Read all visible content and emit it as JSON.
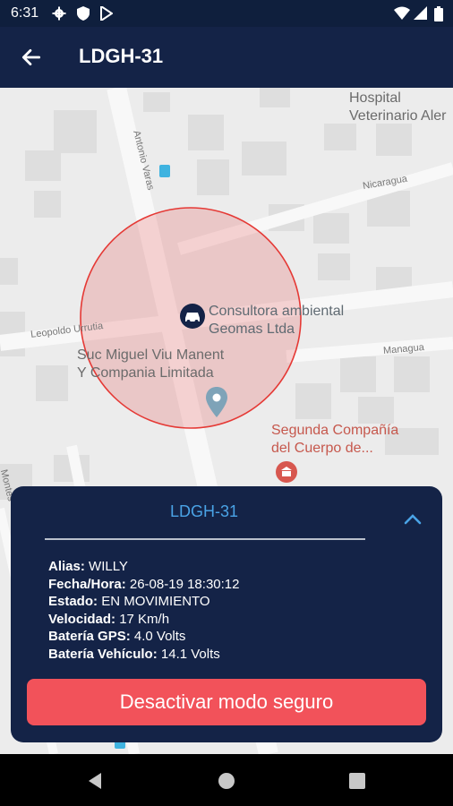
{
  "status_bar": {
    "time": "6:31"
  },
  "app_bar": {
    "title": "LDGH-31"
  },
  "map": {
    "labels": {
      "hospital": "Hospital\nVeterinario Aler",
      "consultora": "Consultora ambiental\nGeomas Ltda",
      "suc": "Suc Miguel Viu Manent\nY Compania Limitada",
      "segunda": "Segunda Compañía\ndel Cuerpo de...",
      "nicaragua": "Nicaragua",
      "managua": "Managua",
      "leopoldo": "Leopoldo Urrutia",
      "antonio": "Antonio Varas",
      "montes": "Montes"
    }
  },
  "info_card": {
    "title": "LDGH-31",
    "rows": [
      {
        "label": "Alias:",
        "value": "WILLY"
      },
      {
        "label": "Fecha/Hora:",
        "value": "26-08-19 18:30:12"
      },
      {
        "label": "Estado:",
        "value": "EN MOVIMIENTO"
      },
      {
        "label": "Velocidad:",
        "value": "17 Km/h"
      },
      {
        "label": "Batería GPS:",
        "value": "4.0 Volts"
      },
      {
        "label": "Batería Vehículo:",
        "value": "14.1 Volts"
      }
    ],
    "button_label": "Desactivar modo seguro"
  },
  "colors": {
    "appbar": "#142347",
    "card": "#142347",
    "accent": "#4aa3e6",
    "button": "#f2525a",
    "geofence": "#e53935"
  },
  "icons": [
    "settings-icon",
    "shield-icon",
    "play-store-icon",
    "wifi-icon",
    "signal-icon",
    "battery-icon",
    "back-arrow-icon",
    "car-marker-icon",
    "location-pin-icon",
    "museum-icon",
    "chevron-up-icon",
    "nav-back-icon",
    "nav-home-icon",
    "nav-recents-icon"
  ]
}
